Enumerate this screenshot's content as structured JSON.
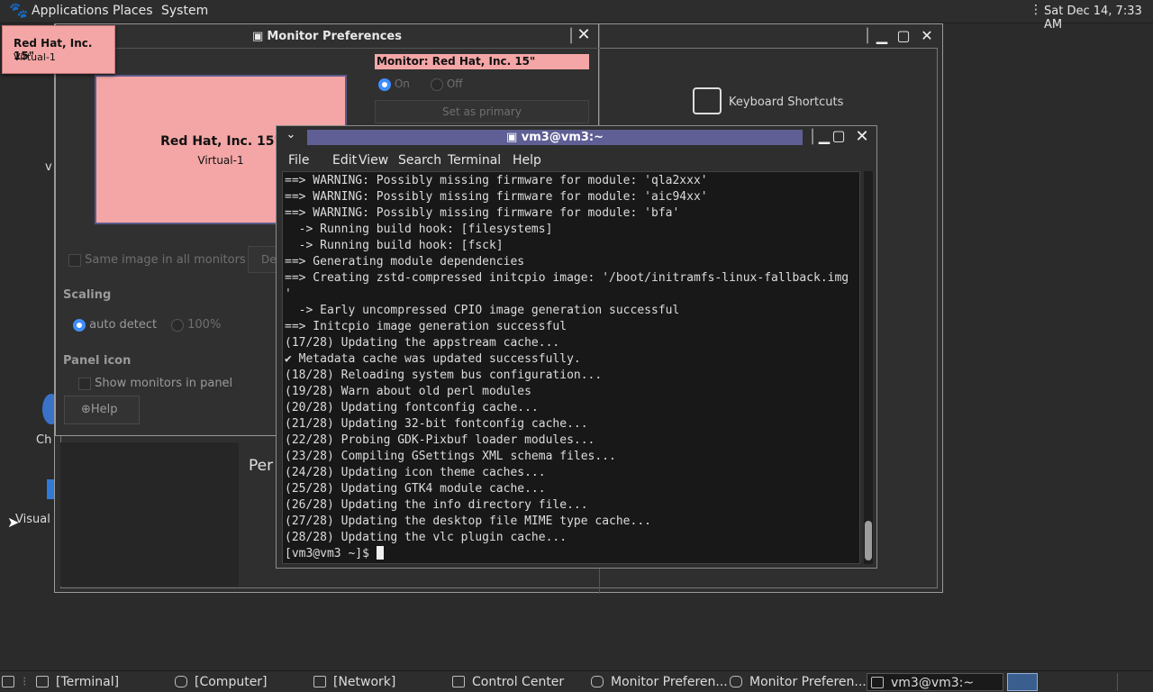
{
  "top_panel": {
    "applications": "Applications",
    "places": "Places",
    "system": "System",
    "clock": "Sat Dec 14, 7:33 AM"
  },
  "tooltip": {
    "title": "Red Hat, Inc. 15\"",
    "subtitle": "Virtual-1"
  },
  "monitor_prefs": {
    "title": "Monitor Preferences",
    "monitor_header": "Monitor: Red Hat, Inc. 15\"",
    "on_label": "On",
    "off_label": "Off",
    "set_primary": "Set as primary",
    "preview_title": "Red Hat, Inc. 15\"",
    "preview_sub": "Virtual-1",
    "same_image": "Same image in all monitors",
    "detect_button": "De",
    "scaling_label": "Scaling",
    "auto_detect": "auto detect",
    "scale_100": "100%",
    "panel_icon_label": "Panel icon",
    "show_monitors": "Show monitors in panel",
    "help_button": "Help"
  },
  "control_center": {
    "keyboard_shortcuts": "Keyboard Shortcuts",
    "per_label": "Per"
  },
  "desktop": {
    "icon_label_1": "Ch",
    "icon_label_2": "Visual S",
    "icon_label_v": "v"
  },
  "terminal": {
    "title": "vm3@vm3:~",
    "menu": [
      "File",
      "Edit",
      "View",
      "Search",
      "Terminal",
      "Help"
    ],
    "lines": [
      "==> WARNING: Possibly missing firmware for module: 'qla2xxx'",
      "==> WARNING: Possibly missing firmware for module: 'aic94xx'",
      "==> WARNING: Possibly missing firmware for module: 'bfa'",
      "  -> Running build hook: [filesystems]",
      "  -> Running build hook: [fsck]",
      "==> Generating module dependencies",
      "==> Creating zstd-compressed initcpio image: '/boot/initramfs-linux-fallback.img",
      "'",
      "  -> Early uncompressed CPIO image generation successful",
      "==> Initcpio image generation successful",
      "(17/28) Updating the appstream cache...",
      "✔ Metadata cache was updated successfully.",
      "(18/28) Reloading system bus configuration...",
      "(19/28) Warn about old perl modules",
      "(20/28) Updating fontconfig cache...",
      "(21/28) Updating 32-bit fontconfig cache...",
      "(22/28) Probing GDK-Pixbuf loader modules...",
      "(23/28) Compiling GSettings XML schema files...",
      "(24/28) Updating icon theme caches...",
      "(25/28) Updating GTK4 module cache...",
      "(26/28) Updating the info directory file...",
      "(27/28) Updating the desktop file MIME type cache...",
      "(28/28) Updating the vlc plugin cache...",
      "[vm3@vm3 ~]$ "
    ]
  },
  "taskbar": {
    "items": [
      "[Terminal]",
      "[Computer]",
      "[Network]",
      "Control Center",
      "Monitor Preferen...",
      "Monitor Preferen...",
      "vm3@vm3:~"
    ]
  },
  "colors": {
    "monitor_pink": "#f4a6a6",
    "title_highlight": "#5f5f95",
    "radio_blue": "#3c8cff"
  }
}
